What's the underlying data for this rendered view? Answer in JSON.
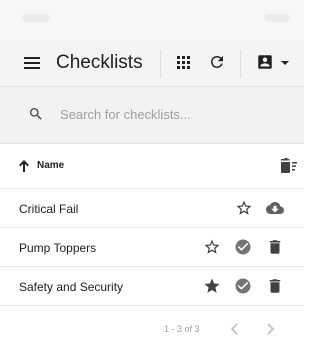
{
  "appbar": {
    "title": "Checklists"
  },
  "search": {
    "placeholder": "Search for checklists..."
  },
  "table": {
    "sort_column": "Name",
    "rows": [
      {
        "name": "Critical Fail",
        "starred": false,
        "status": "cloud-download-icon"
      },
      {
        "name": "Pump Toppers",
        "starred": false,
        "status": "check-circle-icon"
      },
      {
        "name": "Safety and Security",
        "starred": true,
        "status": "check-circle-icon"
      }
    ]
  },
  "pagination": {
    "range": "1 - 3 of 3"
  },
  "colors": {
    "text": "#212121",
    "icon_dark": "#212121",
    "icon_muted": "#757575",
    "placeholder": "#9e9e9e",
    "appbar_bg": "#f4f4f4"
  }
}
